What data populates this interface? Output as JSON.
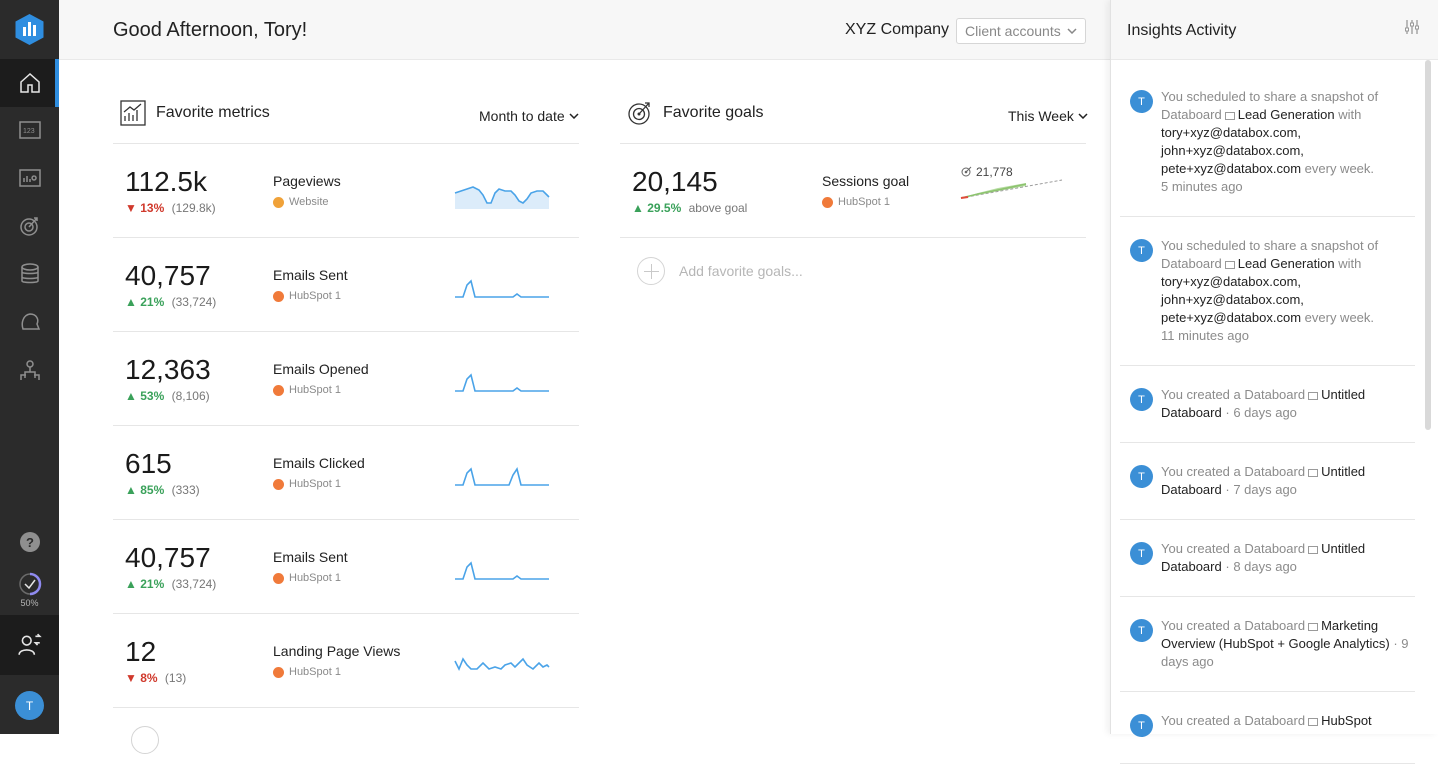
{
  "sidebar": {
    "nav": [
      "home",
      "numbers",
      "dashboards",
      "goals",
      "data",
      "alerts",
      "users"
    ],
    "progress_label": "50%",
    "avatar_initial": "T"
  },
  "header": {
    "greeting": "Good Afternoon, Tory!",
    "company": "XYZ Company",
    "client_select": "Client accounts"
  },
  "metrics": {
    "title": "Favorite metrics",
    "range": "Month to date",
    "rows": [
      {
        "value": "112.5k",
        "change": "13%",
        "dir": "down",
        "previous": "(129.8k)",
        "name": "Pageviews",
        "source": "Website",
        "source_color": "#f0a239"
      },
      {
        "value": "40,757",
        "change": "21%",
        "dir": "up",
        "previous": "(33,724)",
        "name": "Emails Sent",
        "source": "HubSpot 1",
        "source_color": "#f07a3a"
      },
      {
        "value": "12,363",
        "change": "53%",
        "dir": "up",
        "previous": "(8,106)",
        "name": "Emails Opened",
        "source": "HubSpot 1",
        "source_color": "#f07a3a"
      },
      {
        "value": "615",
        "change": "85%",
        "dir": "up",
        "previous": "(333)",
        "name": "Emails Clicked",
        "source": "HubSpot 1",
        "source_color": "#f07a3a"
      },
      {
        "value": "40,757",
        "change": "21%",
        "dir": "up",
        "previous": "(33,724)",
        "name": "Emails Sent",
        "source": "HubSpot 1",
        "source_color": "#f07a3a"
      },
      {
        "value": "12",
        "change": "8%",
        "dir": "down",
        "previous": "(13)",
        "name": "Landing Page Views",
        "source": "HubSpot 1",
        "source_color": "#f07a3a"
      }
    ]
  },
  "goals": {
    "title": "Favorite goals",
    "range": "This Week",
    "rows": [
      {
        "value": "20,145",
        "change": "29.5%",
        "change_suffix": "above goal",
        "name": "Sessions goal",
        "source": "HubSpot 1",
        "target": "21,778"
      }
    ],
    "add_placeholder": "Add favorite goals..."
  },
  "insights": {
    "title": "Insights Activity",
    "items": [
      {
        "pre": "You scheduled to share a snapshot of Databoard",
        "board": "Lead Generation",
        "post": "with",
        "emails": "tory+xyz@databox.com, john+xyz@databox.com, pete+xyz@databox.com",
        "suffix": "every week.",
        "time": "5 minutes ago"
      },
      {
        "pre": "You scheduled to share a snapshot of Databoard",
        "board": "Lead Generation",
        "post": "with",
        "emails": "tory+xyz@databox.com, john+xyz@databox.com, pete+xyz@databox.com",
        "suffix": "every week.",
        "time": "11 minutes ago"
      },
      {
        "pre": "You created a Databoard",
        "board": "Untitled Databoard",
        "time": "6 days ago"
      },
      {
        "pre": "You created a Databoard",
        "board": "Untitled Databoard",
        "time": "7 days ago"
      },
      {
        "pre": "You created a Databoard",
        "board": "Untitled Databoard",
        "time": "8 days ago"
      },
      {
        "pre": "You created a Databoard",
        "board": "Marketing Overview (HubSpot + Google Analytics)",
        "time": "9 days ago"
      },
      {
        "pre": "You created a Databoard",
        "board": "HubSpot",
        "time": ""
      }
    ]
  },
  "colors": {
    "accent": "#2f8ee0",
    "up": "#3aa15a",
    "down": "#d0392c",
    "spark": "#4aa3e8"
  }
}
